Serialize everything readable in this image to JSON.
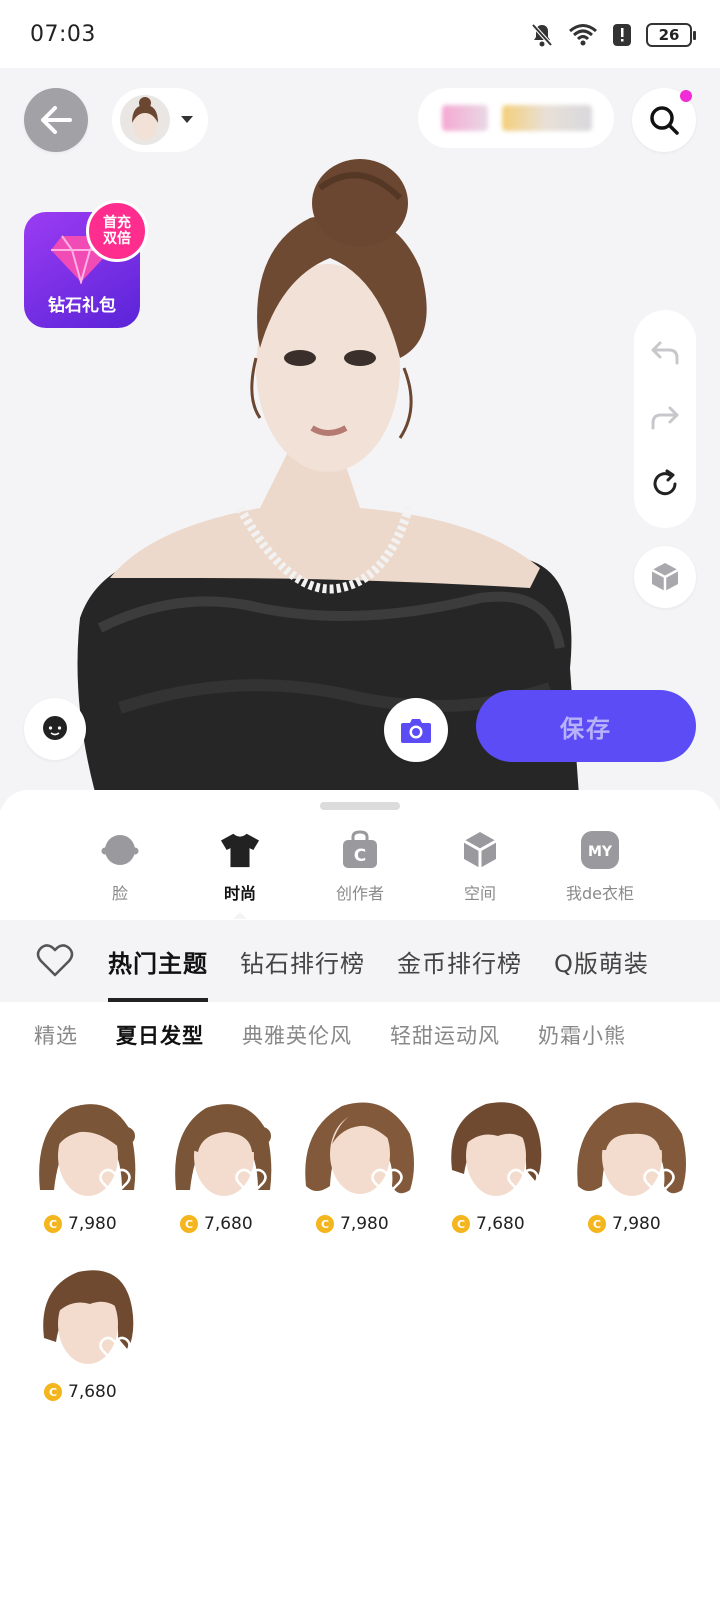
{
  "status_bar": {
    "time": "07:03",
    "battery": "26"
  },
  "header": {
    "save_label": "保存"
  },
  "promo": {
    "pack_label": "钻石礼包",
    "badge_line1": "首充",
    "badge_line2": "双倍"
  },
  "categories": [
    {
      "label": "脸",
      "icon": "face-icon"
    },
    {
      "label": "时尚",
      "icon": "tshirt-icon"
    },
    {
      "label": "创作者",
      "icon": "creator-bag-icon"
    },
    {
      "label": "空间",
      "icon": "cube-icon"
    },
    {
      "label": "我de衣柜",
      "icon": "my-wardrobe-icon"
    }
  ],
  "category_my_badge": "MY",
  "creator_badge": "C",
  "theme_tabs": [
    "热门主题",
    "钻石排行榜",
    "金币排行榜",
    "Q版萌装"
  ],
  "style_tabs": [
    "精选",
    "夏日发型",
    "典雅英伦风",
    "轻甜运动风",
    "奶霜小熊"
  ],
  "coin_symbol": "C",
  "items": [
    {
      "price": "7,980",
      "hair": "bun-side"
    },
    {
      "price": "7,680",
      "hair": "bun-side-bangs"
    },
    {
      "price": "7,980",
      "hair": "wavy"
    },
    {
      "price": "7,680",
      "hair": "short-bob"
    },
    {
      "price": "7,980",
      "hair": "wavy-bangs"
    },
    {
      "price": "7,680",
      "hair": "short-bob"
    }
  ],
  "colors": {
    "accent": "#5b4cf6",
    "badge_pink": "#ff2d8e",
    "coin": "#f5b51d",
    "hair": "#7a5537"
  }
}
